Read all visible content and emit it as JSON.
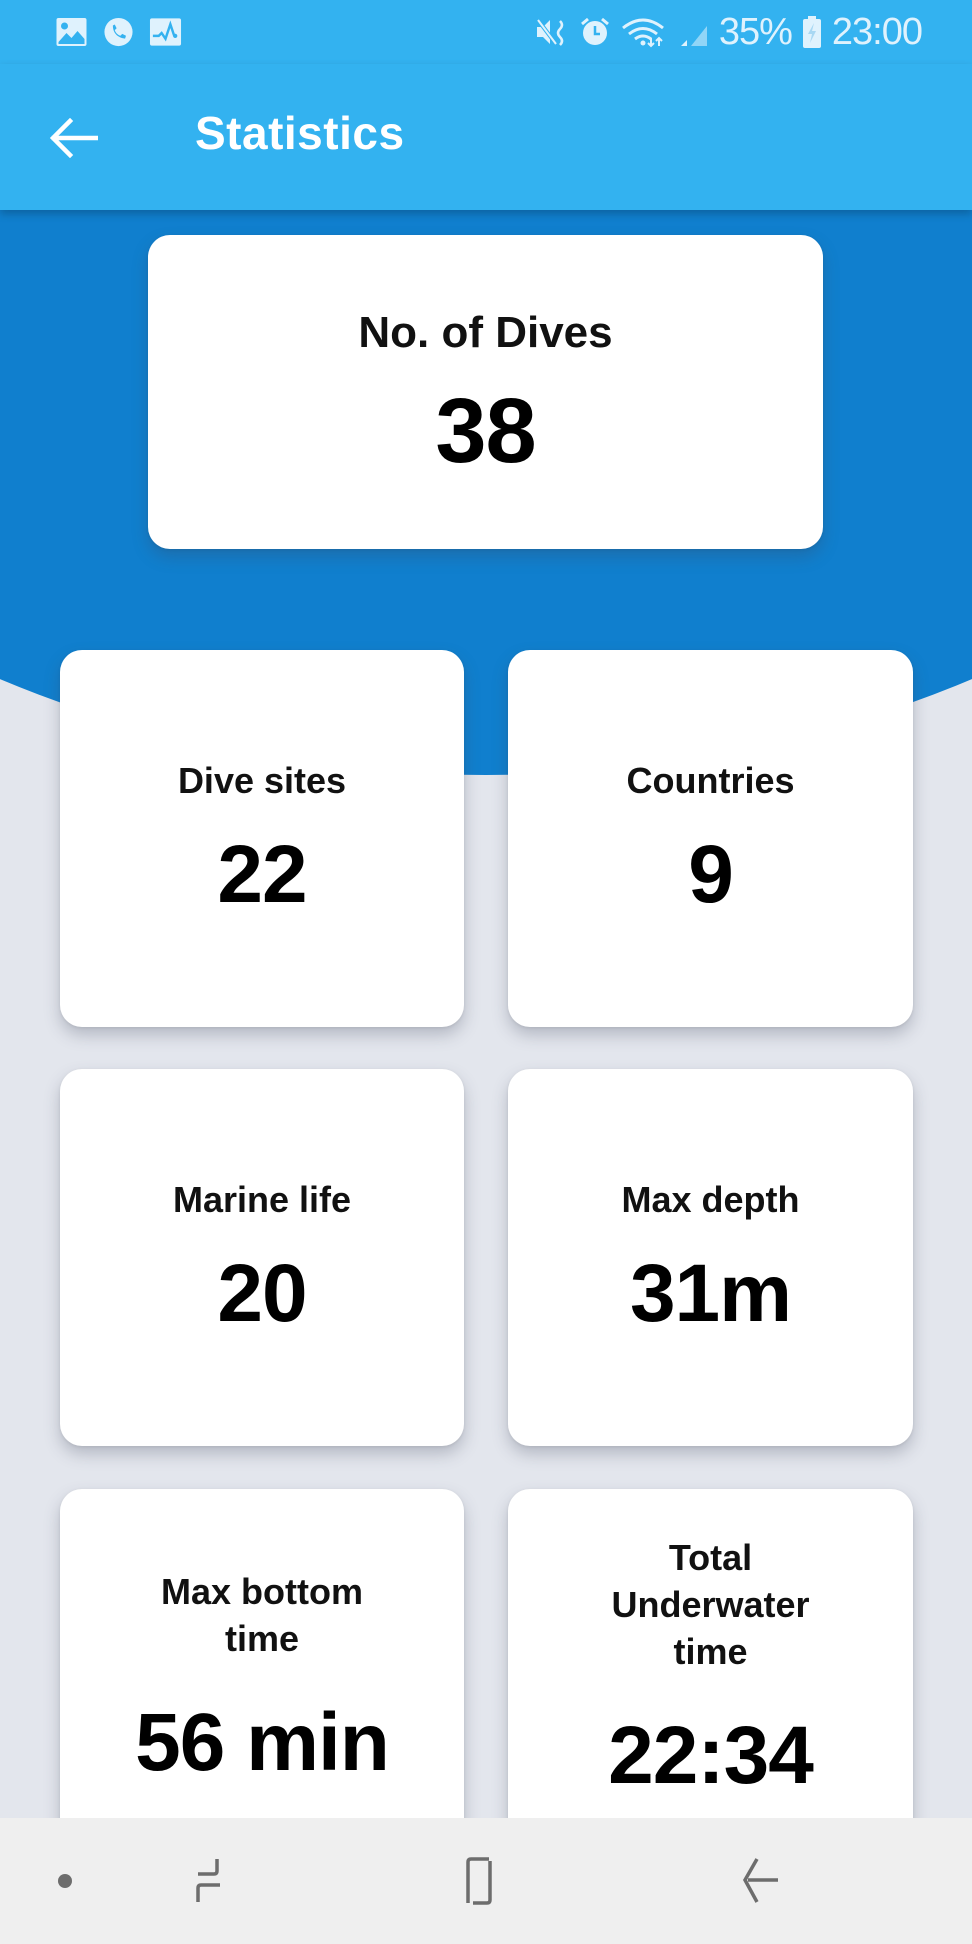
{
  "status_bar": {
    "left_icons": [
      "gallery-icon",
      "phone-call-icon",
      "activity-icon"
    ],
    "right_icons": [
      "vibrate-mute-icon",
      "alarm-icon",
      "wifi-icon",
      "signal-icon"
    ],
    "battery_percent": "35%",
    "time": "23:00"
  },
  "app_bar": {
    "back_icon": "arrow-left-icon",
    "title": "Statistics"
  },
  "summary": {
    "label": "No. of Dives",
    "value": "38"
  },
  "stats": [
    {
      "label": "Dive sites",
      "value": "22"
    },
    {
      "label": "Countries",
      "value": "9"
    },
    {
      "label": "Marine life",
      "value": "20"
    },
    {
      "label": "Max depth",
      "value": "31m"
    },
    {
      "label": "Max bottom time",
      "value": "56 min"
    },
    {
      "label": "Total Underwater time",
      "value": "22:34"
    }
  ],
  "nav_bar": {
    "buttons": [
      "dot-indicator",
      "recent-apps-icon",
      "home-icon",
      "back-icon"
    ]
  },
  "colors": {
    "app_bar": "#33b2f0",
    "backdrop": "#107fce",
    "page_bg": "#e3e6ed",
    "card_bg": "#ffffff"
  }
}
